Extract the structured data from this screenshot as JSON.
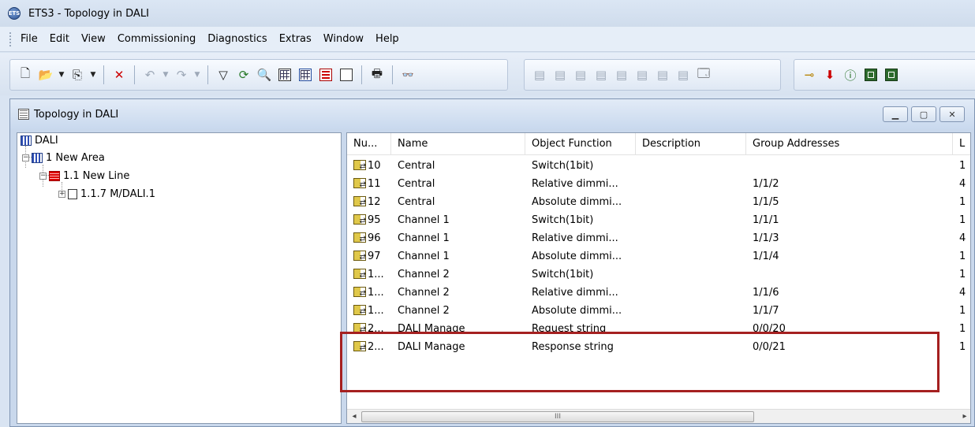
{
  "window": {
    "title": "ETS3 - Topology in DALI",
    "app_icon_text": "ETS"
  },
  "menu": [
    "File",
    "Edit",
    "View",
    "Commissioning",
    "Diagnostics",
    "Extras",
    "Window",
    "Help"
  ],
  "toolbar": {
    "icons_1": [
      "new-icon",
      "open-icon",
      "copy-icon",
      "delete-icon",
      "undo-icon",
      "redo-icon",
      "filter-icon",
      "refresh-icon",
      "zoom-icon",
      "window-icon",
      "table-icon",
      "red-grid-icon",
      "window-frame-icon",
      "print-icon",
      "find-icon"
    ],
    "icons_2": [
      "mark-1-icon",
      "mark-2-icon",
      "mark-3-icon",
      "mark-4-icon",
      "mark-5-icon",
      "mark-6-icon",
      "mark-7-icon",
      "mark-8-icon",
      "properties-icon"
    ],
    "icons_3": [
      "connect-icon",
      "download-icon",
      "info-icon",
      "monitor-icon",
      "graph-icon"
    ]
  },
  "mdi": {
    "title": "Topology in DALI"
  },
  "tree": {
    "root": "DALI",
    "area": "1 New Area",
    "line": "1.1 New Line",
    "device": "1.1.7 M/DALI.1"
  },
  "list": {
    "columns": [
      "Nu...",
      "Name",
      "Object Function",
      "Description",
      "Group Addresses",
      "L"
    ],
    "rows": [
      {
        "num": "10",
        "name": "Central",
        "func": "Switch(1bit)",
        "desc": "",
        "ga": "",
        "len": "1"
      },
      {
        "num": "11",
        "name": "Central",
        "func": "Relative dimmi...",
        "desc": "",
        "ga": "1/1/2",
        "len": "4"
      },
      {
        "num": "12",
        "name": "Central",
        "func": "Absolute dimmi...",
        "desc": "",
        "ga": "1/1/5",
        "len": "1"
      },
      {
        "num": "95",
        "name": "Channel 1",
        "func": "Switch(1bit)",
        "desc": "",
        "ga": "1/1/1",
        "len": "1"
      },
      {
        "num": "96",
        "name": "Channel 1",
        "func": "Relative dimmi...",
        "desc": "",
        "ga": "1/1/3",
        "len": "4"
      },
      {
        "num": "97",
        "name": "Channel 1",
        "func": "Absolute dimmi...",
        "desc": "",
        "ga": "1/1/4",
        "len": "1"
      },
      {
        "num": "1...",
        "name": "Channel 2",
        "func": "Switch(1bit)",
        "desc": "",
        "ga": "",
        "len": "1"
      },
      {
        "num": "1...",
        "name": "Channel 2",
        "func": "Relative dimmi...",
        "desc": "",
        "ga": "1/1/6",
        "len": "4"
      },
      {
        "num": "1...",
        "name": "Channel 2",
        "func": "Absolute dimmi...",
        "desc": "",
        "ga": "1/1/7",
        "len": "1"
      },
      {
        "num": "2...",
        "name": "DALI Manage",
        "func": "Request string",
        "desc": "",
        "ga": "0/0/20",
        "len": "1"
      },
      {
        "num": "2...",
        "name": "DALI Manage",
        "func": "Response string",
        "desc": "",
        "ga": "0/0/21",
        "len": "1"
      }
    ],
    "scroll_thumb": "III"
  },
  "colors": {
    "highlight": "#a52020",
    "titlebar": "#d6e2f2"
  }
}
